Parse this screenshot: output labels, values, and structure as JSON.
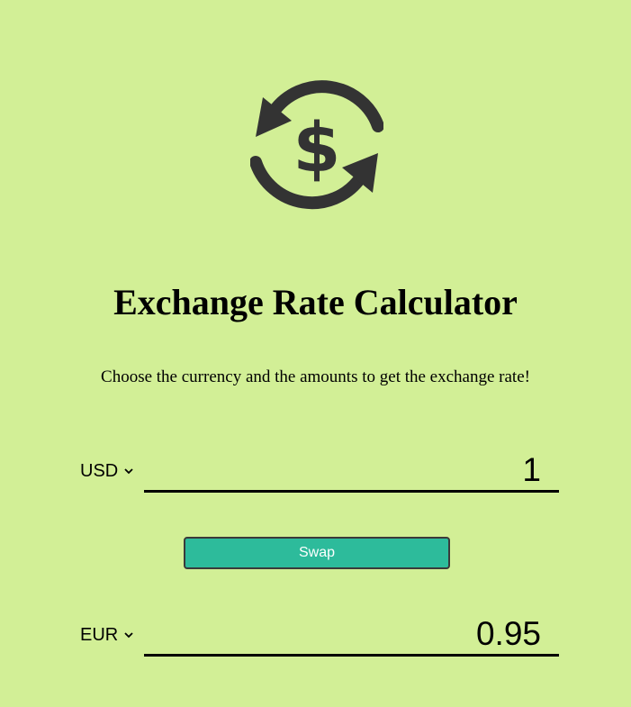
{
  "header": {
    "logo_icon": "currency-exchange-icon",
    "title": "Exchange Rate Calculator",
    "subtitle": "Choose the currency and the amounts to get the exchange rate!"
  },
  "converter": {
    "from": {
      "currency": "USD",
      "amount": "1"
    },
    "swap_label": "Swap",
    "to": {
      "currency": "EUR",
      "amount": "0.95"
    }
  },
  "colors": {
    "background": "#d2ef96",
    "button": "#2dbb9b",
    "icon": "#333333"
  }
}
